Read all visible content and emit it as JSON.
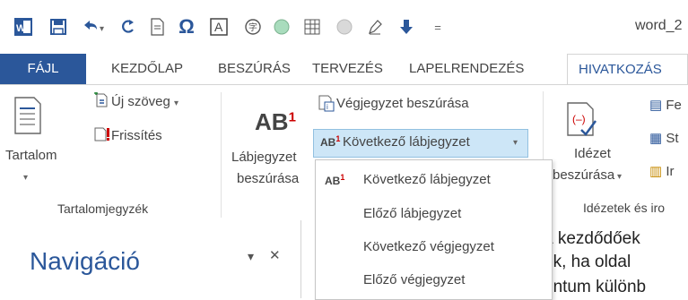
{
  "window": {
    "title": "word_2"
  },
  "qat": {
    "icons": [
      "word-app-icon",
      "save-icon",
      "undo-icon",
      "redo-icon",
      "document-icon",
      "omega-icon",
      "textbox-icon",
      "stamp-icon",
      "circle-icon",
      "table-icon",
      "circle-icon-2",
      "pen-icon",
      "down-arrow-icon",
      "customize-icon"
    ]
  },
  "tabs": [
    {
      "label": "FÁJL"
    },
    {
      "label": "KEZDŐLAP"
    },
    {
      "label": "BESZÚRÁS"
    },
    {
      "label": "TERVEZÉS"
    },
    {
      "label": "LAPELRENDEZÉS"
    },
    {
      "label": "HIVATKOZÁS"
    }
  ],
  "ribbon": {
    "toc": {
      "label": "Tartalom",
      "update_text": "Új szöveg",
      "refresh": "Frissítés",
      "group_label": "Tartalomjegyzék"
    },
    "footnotes": {
      "insert_label_1": "Lábjegyzet",
      "insert_label_2": "beszúrása",
      "ab_text": "AB",
      "sup": "1",
      "endnote_insert": "Végjegyzet beszúrása",
      "next_footnote": "Következő lábjegyzet"
    },
    "citations": {
      "label_1": "Idézet",
      "label_2": "beszúrása",
      "group_label": "Idézetek és iro",
      "cut_1": "Fe",
      "cut_2": "St",
      "cut_3": "Ir"
    }
  },
  "dropdown": {
    "items": [
      {
        "label": "Következő lábjegyzet"
      },
      {
        "label": "Előző lábjegyzet"
      },
      {
        "label": "Következő végjegyzet"
      },
      {
        "label": "Előző végjegyzet"
      }
    ]
  },
  "nav": {
    "title": "Navigáció",
    "menu": "▾",
    "close": "✕"
  },
  "doc": {
    "lines": [
      "a kezdődőek",
      "uk, ha oldal",
      "entum  különb"
    ]
  },
  "colors": {
    "accent": "#2b579a",
    "hover": "#cde6f7"
  }
}
